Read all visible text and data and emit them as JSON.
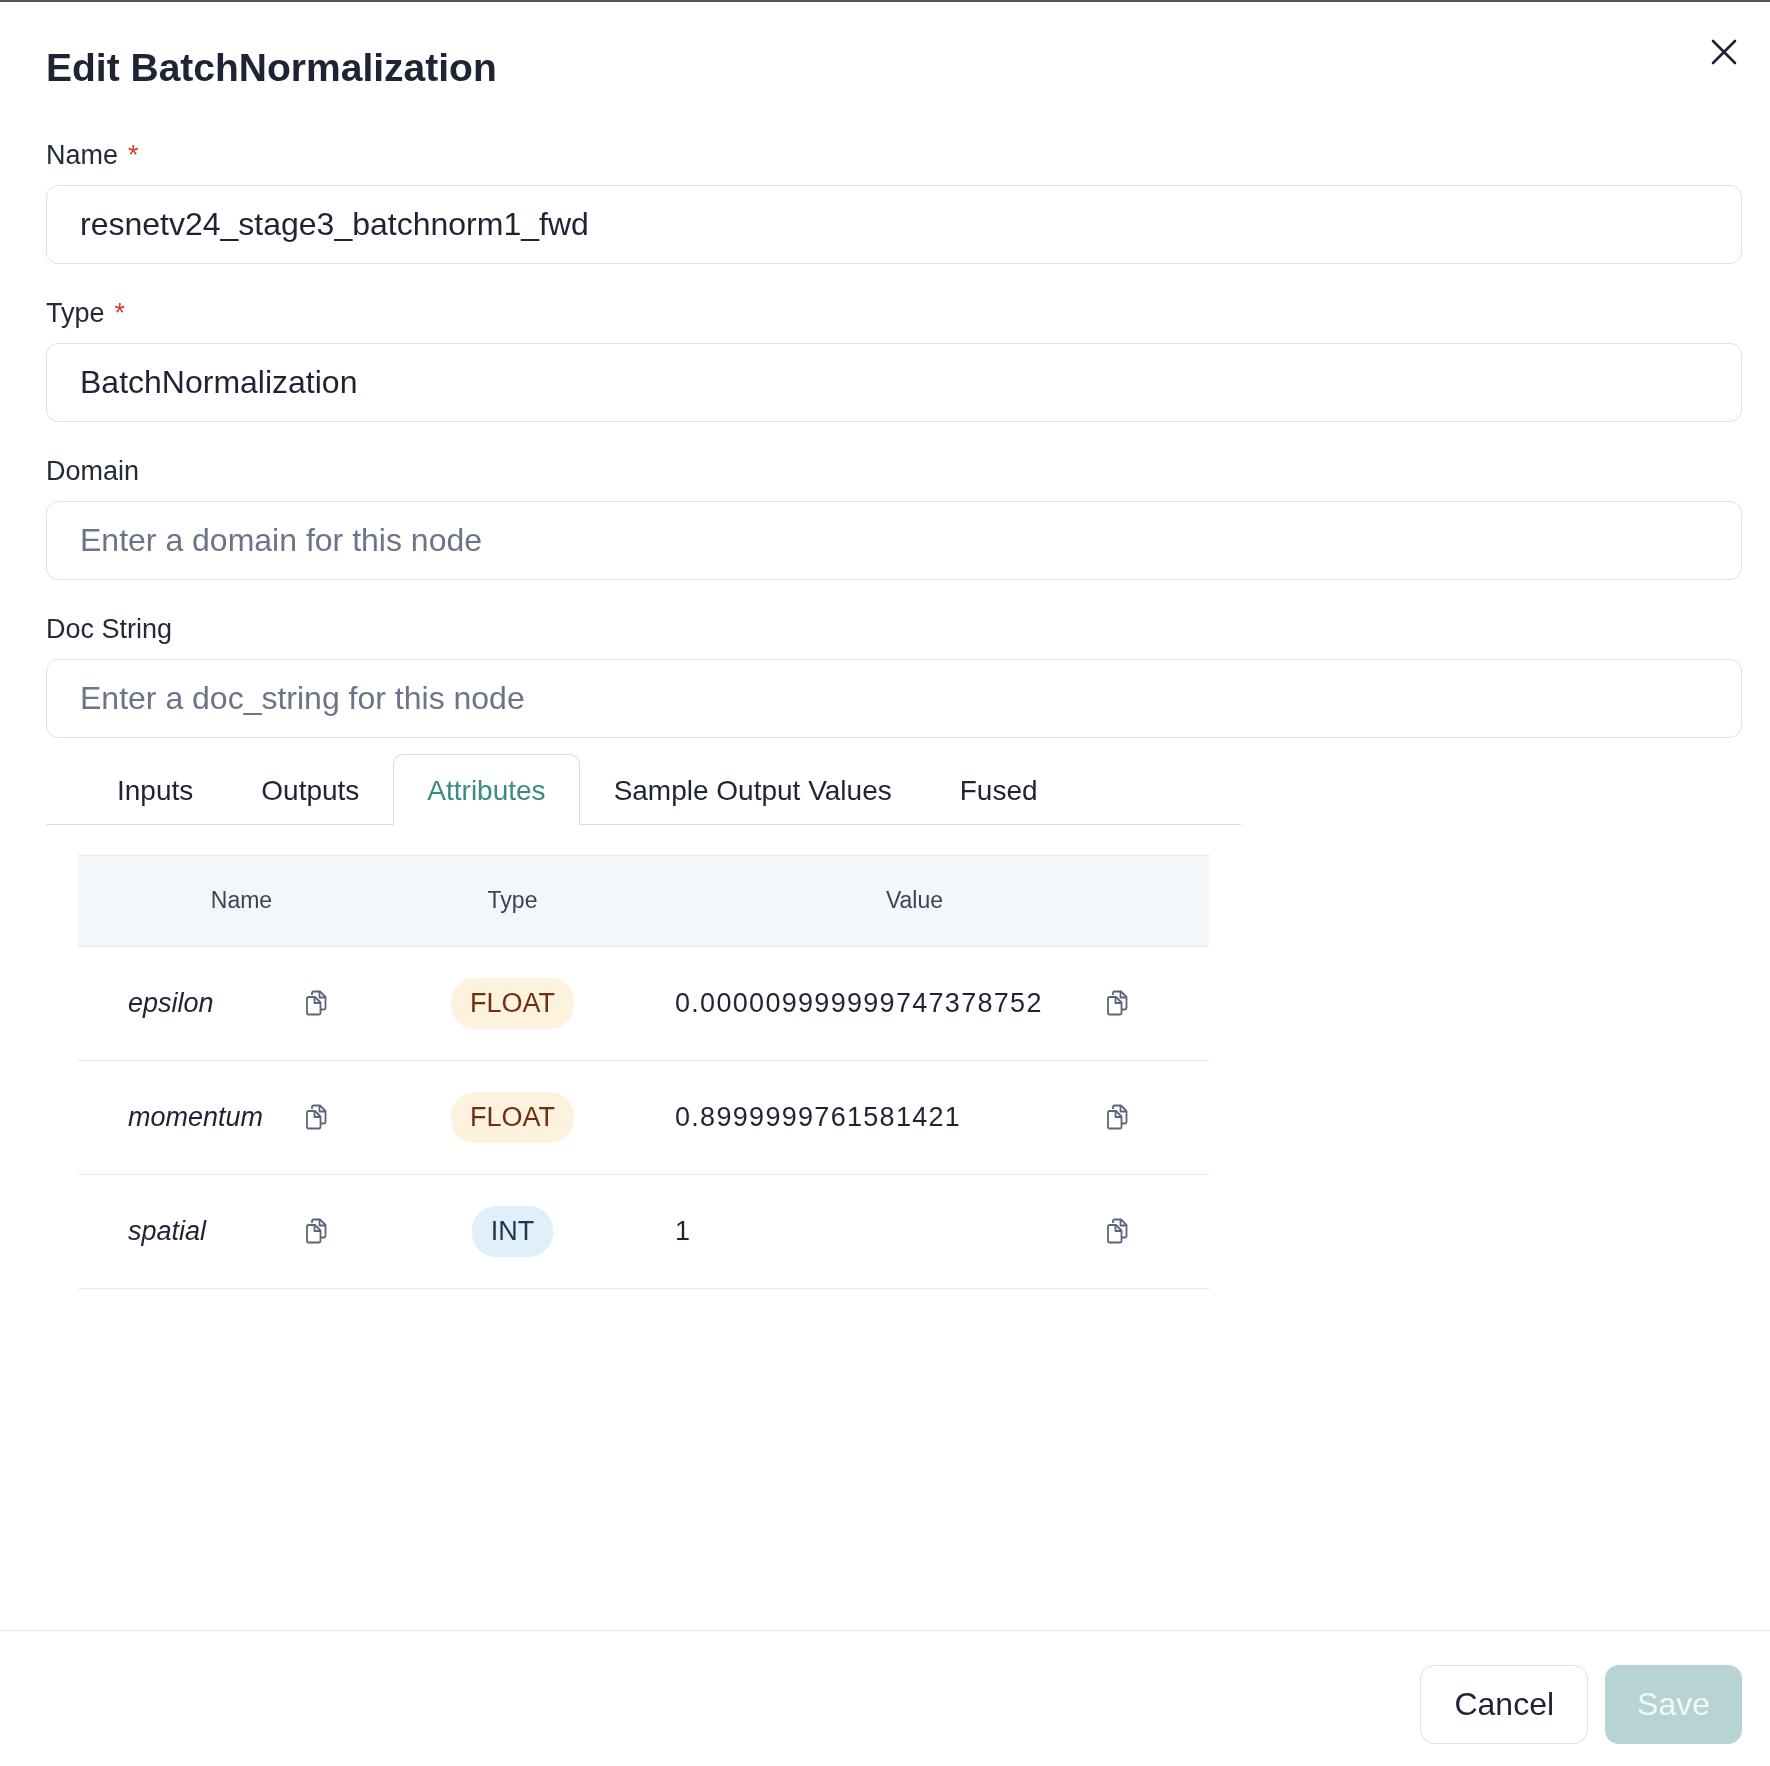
{
  "dialog": {
    "title": "Edit BatchNormalization"
  },
  "fields": [
    {
      "label": "Name",
      "required": true,
      "value": "resnetv24_stage3_batchnorm1_fwd"
    },
    {
      "label": "Type",
      "required": true,
      "value": "BatchNormalization"
    },
    {
      "label": "Domain",
      "required": false,
      "placeholder": "Enter a domain for this node"
    },
    {
      "label": "Doc String",
      "required": false,
      "placeholder": "Enter a doc_string for this node"
    }
  ],
  "required_mark": "*",
  "tabs": [
    {
      "label": "Inputs",
      "selected": false
    },
    {
      "label": "Outputs",
      "selected": false
    },
    {
      "label": "Attributes",
      "selected": true
    },
    {
      "label": "Sample Output Values",
      "selected": false
    },
    {
      "label": "Fused",
      "selected": false
    }
  ],
  "table": {
    "columns": [
      "Name",
      "Type",
      "Value"
    ],
    "rows": [
      {
        "name": "epsilon",
        "type": "FLOAT",
        "kind": "float",
        "value": "0.000009999999747378752"
      },
      {
        "name": "momentum",
        "type": "FLOAT",
        "kind": "float",
        "value": "0.8999999761581421"
      },
      {
        "name": "spatial",
        "type": "INT",
        "kind": "int",
        "value": "1"
      }
    ]
  },
  "buttons": [
    {
      "label": "Cancel",
      "kind": "secondary",
      "disabled": false
    },
    {
      "label": "Save",
      "kind": "primary",
      "disabled": true
    }
  ]
}
